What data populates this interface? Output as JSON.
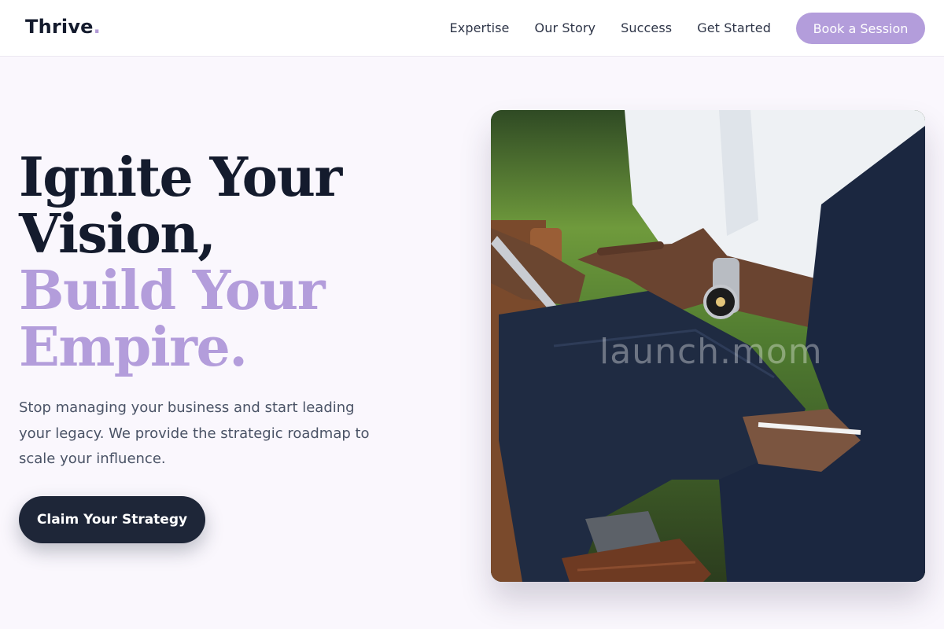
{
  "brand": {
    "name": "Thrive",
    "dot": ".",
    "accent_color": "#b39ddb"
  },
  "nav": {
    "links": [
      "Expertise",
      "Our Story",
      "Success",
      "Get Started"
    ],
    "cta_label": "Book a Session"
  },
  "hero": {
    "headline_dark_1": "Ignite Your",
    "headline_dark_2": "Vision,",
    "headline_accent_1": "Build Your",
    "headline_accent_2": "Empire.",
    "subcopy": "Stop managing your business and start leading your legacy. We provide the strategic roadmap to scale your influence.",
    "cta_label": "Claim Your Strategy"
  },
  "image": {
    "watermark": "launch.mom",
    "subject_icon": "business-meeting-photo"
  },
  "colors": {
    "text_dark": "#141b2d",
    "button_dark": "#1e2638",
    "background": "#faf7fd"
  }
}
